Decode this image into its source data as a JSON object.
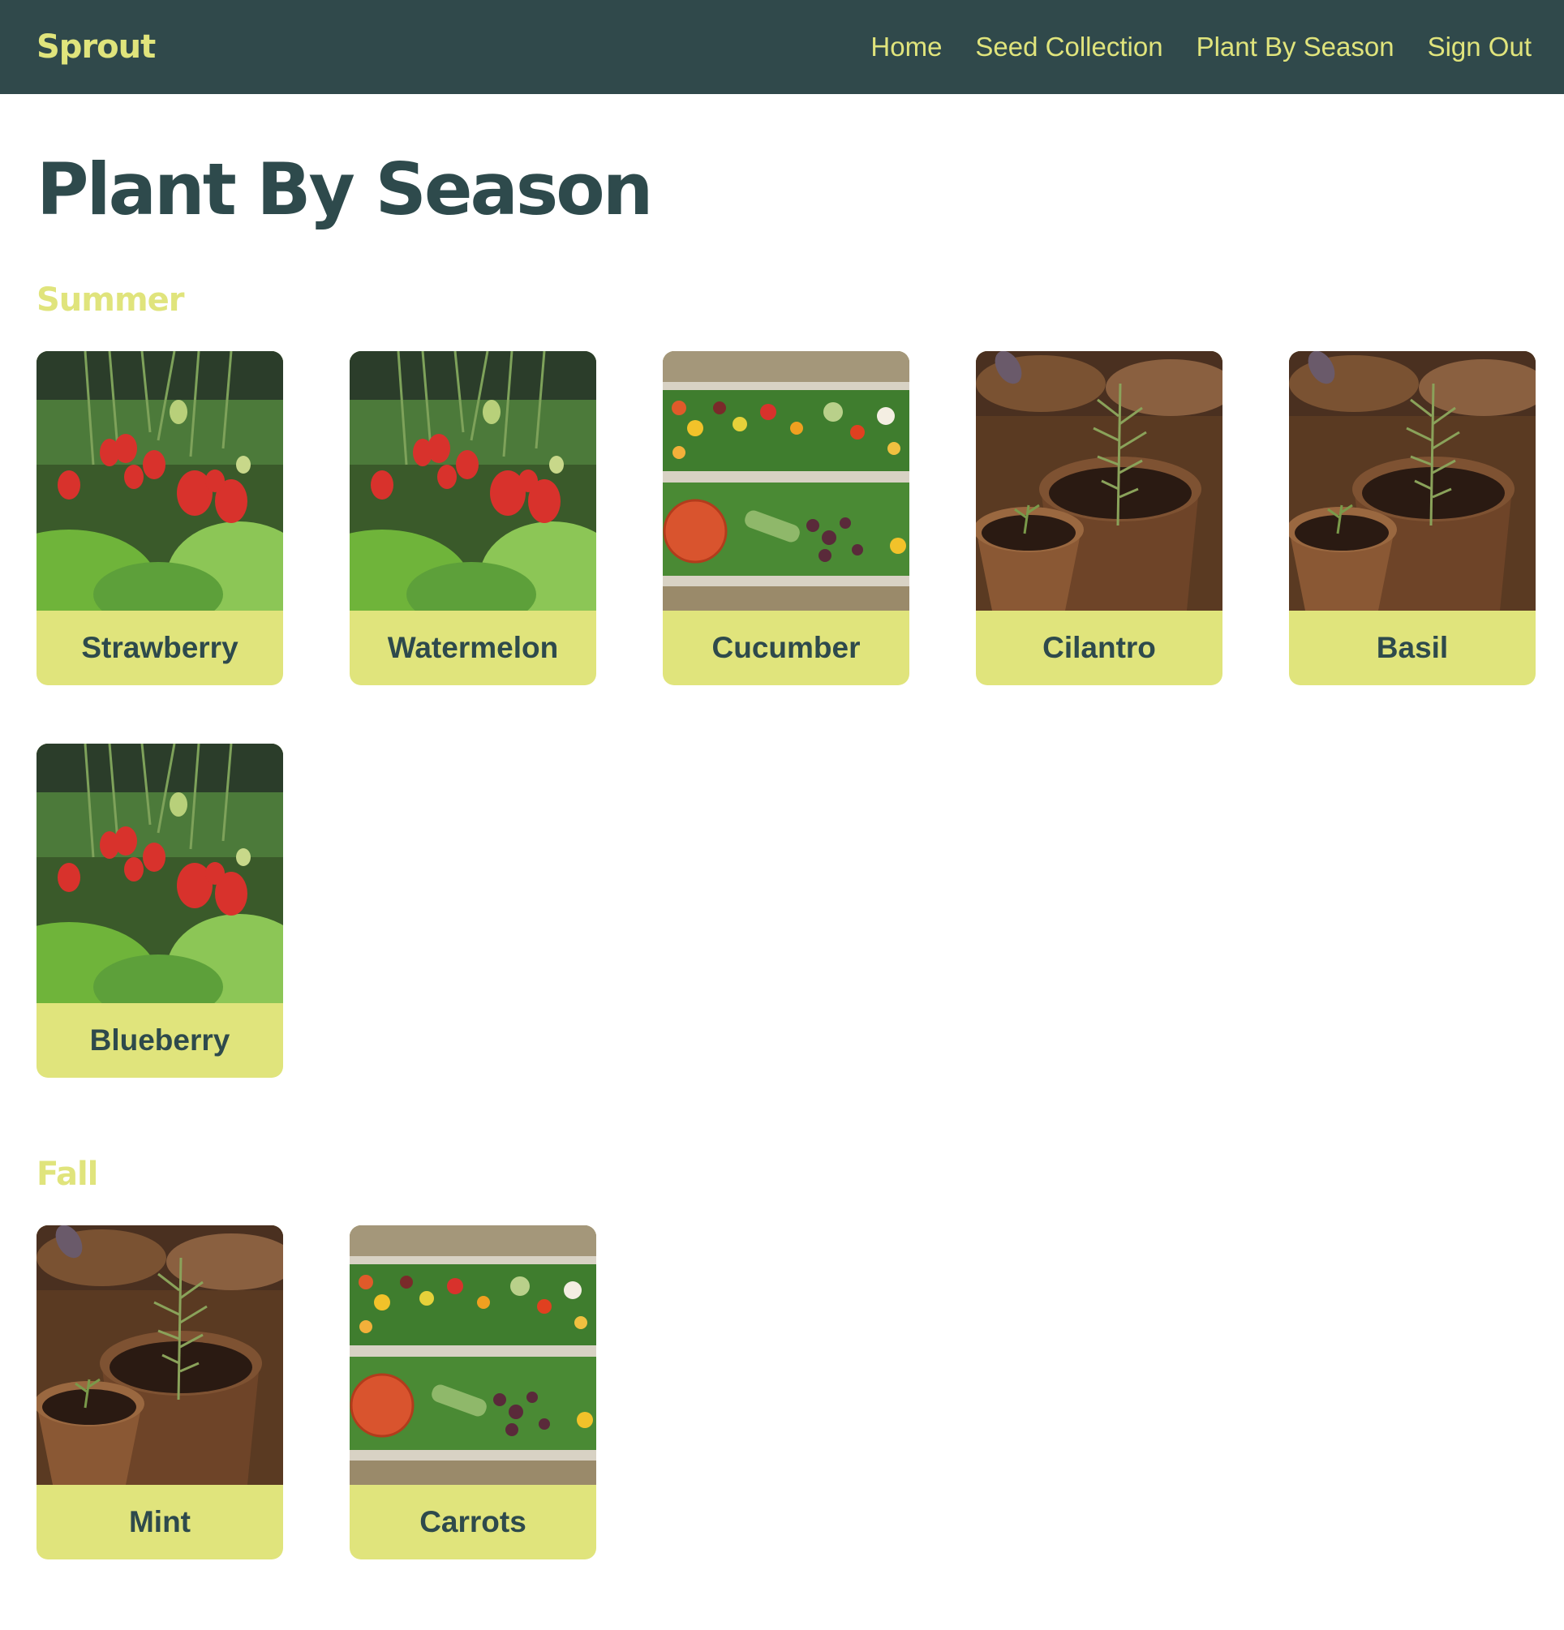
{
  "navbar": {
    "logo": "Sprout",
    "links": [
      {
        "label": "Home"
      },
      {
        "label": "Seed Collection"
      },
      {
        "label": "Plant By Season"
      },
      {
        "label": "Sign Out"
      }
    ]
  },
  "page": {
    "title": "Plant By Season"
  },
  "seasons": [
    {
      "name": "Summer",
      "plants": [
        {
          "label": "Strawberry",
          "image": "strawberry-photo"
        },
        {
          "label": "Watermelon",
          "image": "strawberry-photo"
        },
        {
          "label": "Cucumber",
          "image": "vegetable-crate-photo"
        },
        {
          "label": "Cilantro",
          "image": "seedling-pots-photo"
        },
        {
          "label": "Basil",
          "image": "seedling-pots-photo"
        },
        {
          "label": "Blueberry",
          "image": "strawberry-photo"
        }
      ]
    },
    {
      "name": "Fall",
      "plants": [
        {
          "label": "Mint",
          "image": "seedling-pots-photo"
        },
        {
          "label": "Carrots",
          "image": "vegetable-crate-photo"
        }
      ]
    }
  ],
  "colors": {
    "navbar_bg": "#30494b",
    "accent": "#e0e47c",
    "text_dark": "#2e4a4c"
  }
}
